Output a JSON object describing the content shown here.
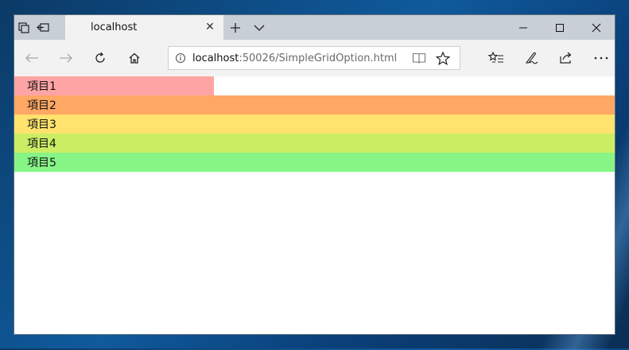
{
  "browser": {
    "tab": {
      "title": "localhost",
      "close_icon": "close-icon"
    },
    "address": {
      "host": "localhost",
      "rest": ":50026/SimpleGridOption.html"
    },
    "icons": {
      "tabs_aside": "tabs-aside-icon",
      "set_aside": "set-aside-icon",
      "new_tab": "plus-icon",
      "tab_list": "chevron-down-icon",
      "minimize": "minimize-icon",
      "maximize": "maximize-icon",
      "close": "close-icon",
      "back": "back-arrow-icon",
      "forward": "forward-arrow-icon",
      "refresh": "refresh-icon",
      "home": "home-icon",
      "info": "info-icon",
      "reading_view": "reading-view-icon",
      "favorite": "star-icon",
      "favorites_hub": "favorites-icon",
      "notes": "pen-icon",
      "share": "share-icon",
      "more": "more-icon"
    }
  },
  "grid": {
    "items": [
      {
        "label": "項目1",
        "color": "#ffa4a4",
        "span": 0.333
      },
      {
        "label": "項目2",
        "color": "#ffa764",
        "span": 1.0
      },
      {
        "label": "項目3",
        "color": "#ffe36e",
        "span": 1.0
      },
      {
        "label": "項目4",
        "color": "#cbed64",
        "span": 1.0
      },
      {
        "label": "項目5",
        "color": "#86f586",
        "span": 1.0
      }
    ]
  }
}
